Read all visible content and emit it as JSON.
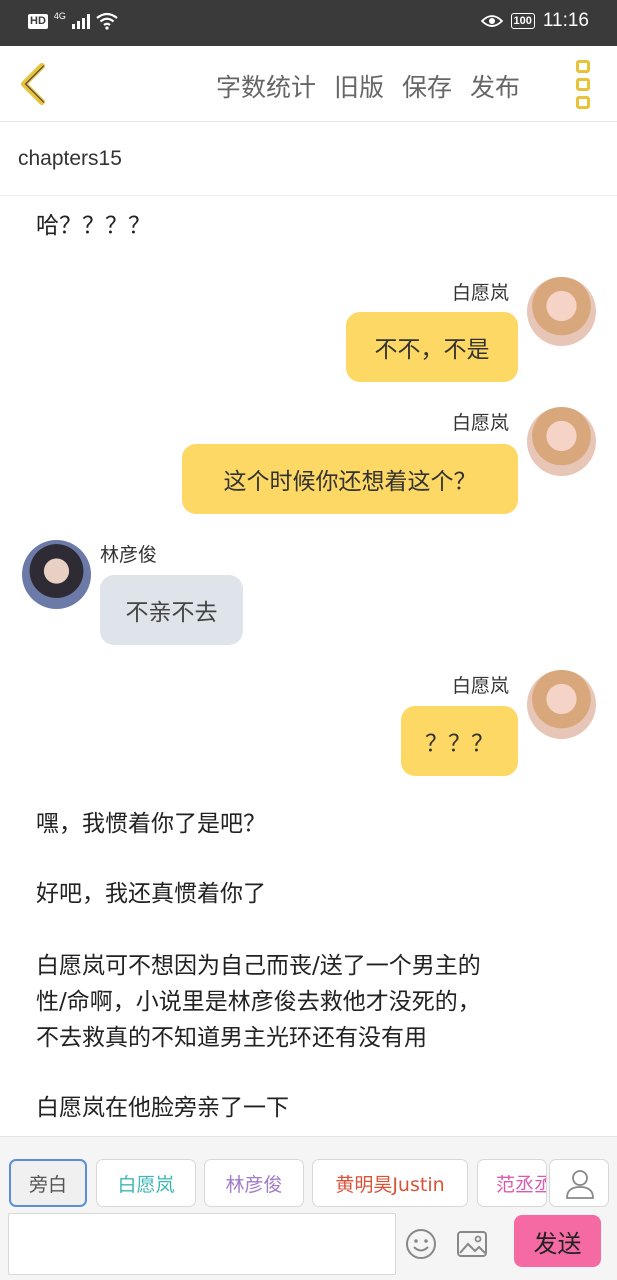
{
  "status_bar": {
    "hd": "HD",
    "network": "4G",
    "battery": "100",
    "time": "11:16"
  },
  "toolbar": {
    "word_count_label": "字数统计",
    "old_version_label": "旧版",
    "save_label": "保存",
    "publish_label": "发布"
  },
  "chapter": {
    "title": "chapters15"
  },
  "content": {
    "narration_top": "哈？？？？",
    "messages": [
      {
        "speaker": "白愿岚",
        "side": "right",
        "text": "不不，不是"
      },
      {
        "speaker": "白愿岚",
        "side": "right",
        "text": "这个时候你还想着这个？"
      },
      {
        "speaker": "林彦俊",
        "side": "left",
        "text": "不亲不去"
      },
      {
        "speaker": "白愿岚",
        "side": "right",
        "text": "？？？"
      }
    ],
    "narration_bottom": [
      "嘿，我惯着你了是吧？",
      "好吧，我还真惯着你了",
      "白愿岚可不想因为自己而丧/送了一个男主的",
      "性/命啊，小说里是林彦俊去救他才没死的，",
      "不去救真的不知道男主光环还有没有用",
      "白愿岚在他脸旁亲了一下"
    ]
  },
  "character_chips": [
    {
      "label": "旁白",
      "color": "#555555"
    },
    {
      "label": "白愿岚",
      "color": "#3db7b5"
    },
    {
      "label": "林彦俊",
      "color": "#a07cc9"
    },
    {
      "label": "黄明昊Justin",
      "color": "#d9533a"
    },
    {
      "label": "范丞丞",
      "color": "#d95bb0"
    }
  ],
  "composer": {
    "input_value": "",
    "send_label": "发送"
  },
  "colors": {
    "accent_yellow": "#fed864",
    "bubble_gray": "#dfe4ea",
    "send_pink": "#f66aa3",
    "selected_chip_border": "#5b8fd6"
  },
  "icons": [
    "back-arrow-icon",
    "more-menu-icon",
    "add-character-icon",
    "emoji-icon",
    "image-icon",
    "eye-icon",
    "wifi-icon",
    "signal-icon"
  ]
}
